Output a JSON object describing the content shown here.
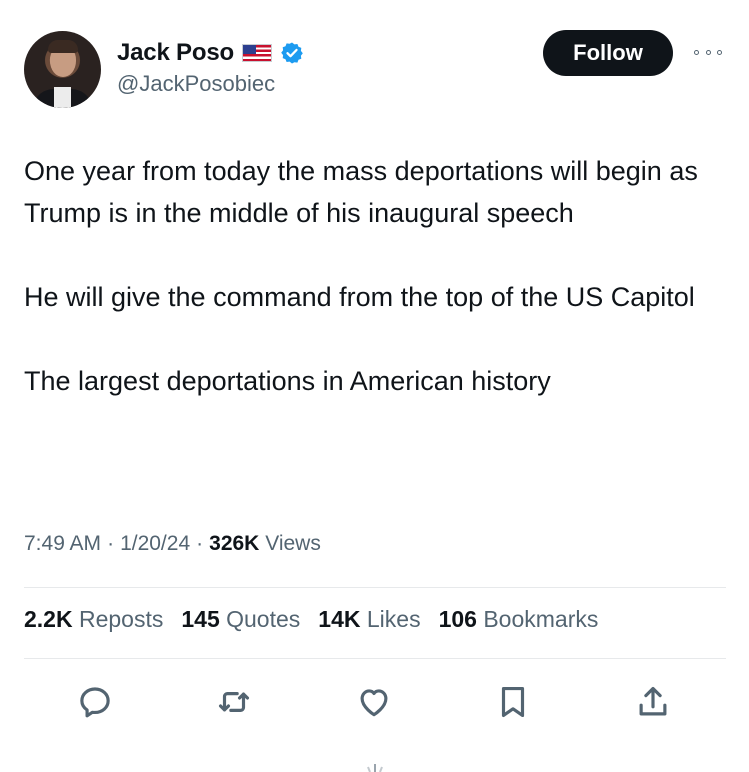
{
  "author": {
    "display_name": "Jack Poso",
    "handle": "@JackPosobiec",
    "flag_emoji_name": "us-flag-icon",
    "verified_color": "#1d9bf0"
  },
  "header": {
    "follow_label": "Follow"
  },
  "tweet": {
    "paragraphs": [
      "One year from today the mass deportations will begin as Trump is in the middle of his inaugural speech",
      "He will give the command from the top of the US Capitol",
      "The largest deportations in American history"
    ]
  },
  "meta": {
    "time": "7:49 AM",
    "sep1": "·",
    "date": "1/20/24",
    "sep2": "·",
    "views_count": "326K",
    "views_label": "Views"
  },
  "stats": {
    "reposts_count": "2.2K",
    "reposts_label": "Reposts",
    "quotes_count": "145",
    "quotes_label": "Quotes",
    "likes_count": "14K",
    "likes_label": "Likes",
    "bookmarks_count": "106",
    "bookmarks_label": "Bookmarks"
  },
  "actions": [
    "reply-icon",
    "repost-icon",
    "like-icon",
    "bookmark-icon",
    "share-icon"
  ],
  "colors": {
    "text_primary": "#0f1419",
    "text_secondary": "#536471",
    "divider": "#e7e9eb",
    "follow_bg": "#0f1419"
  }
}
